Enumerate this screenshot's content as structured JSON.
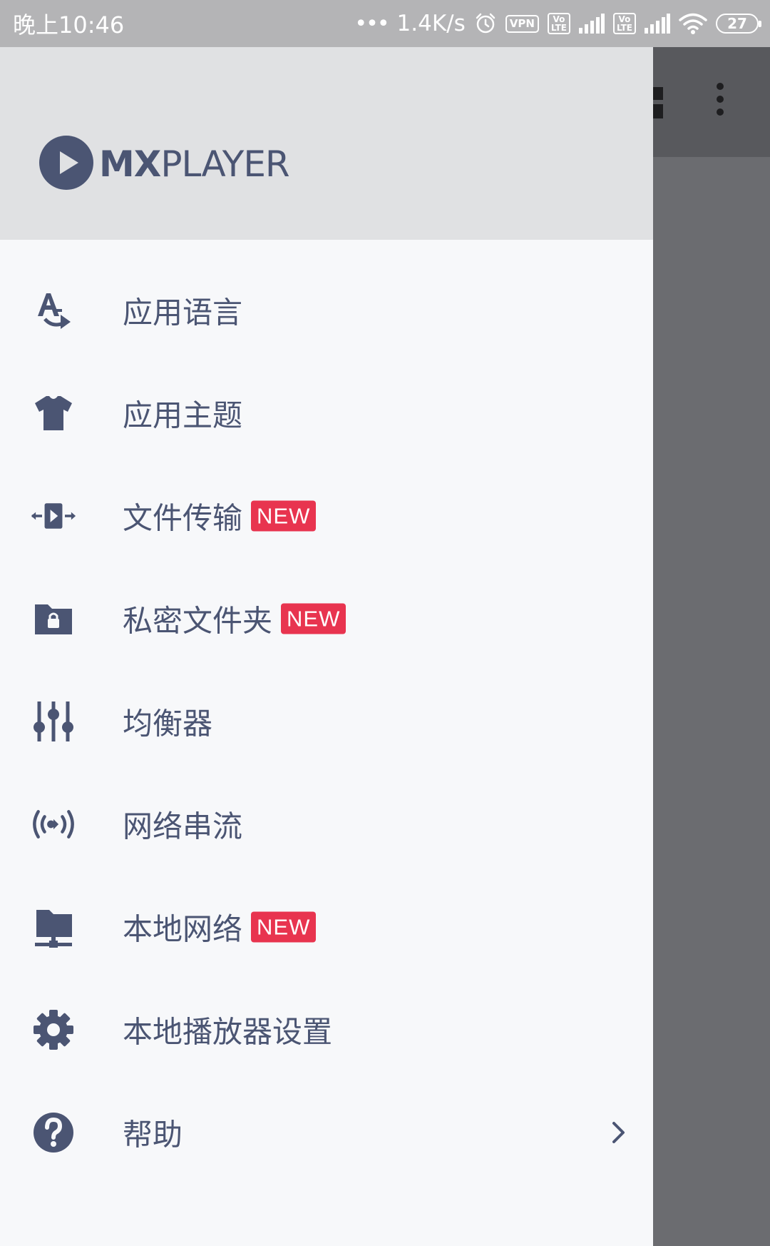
{
  "status_bar": {
    "time": "晚上10:46",
    "dots": "•••",
    "speed": "1.4K/s",
    "vpn": "VPN",
    "volte": [
      "Vo",
      "LTE"
    ],
    "battery": "27"
  },
  "drawer": {
    "logo": {
      "mx": "MX",
      "player": "PLAYER"
    },
    "menu": [
      {
        "icon": "language-icon",
        "label": "应用语言",
        "badge": ""
      },
      {
        "icon": "tshirt-icon",
        "label": "应用主题",
        "badge": ""
      },
      {
        "icon": "file-transfer-icon",
        "label": "文件传输",
        "badge": "NEW"
      },
      {
        "icon": "private-folder-icon",
        "label": "私密文件夹",
        "badge": "NEW"
      },
      {
        "icon": "equalizer-icon",
        "label": "均衡器",
        "badge": ""
      },
      {
        "icon": "network-stream-icon",
        "label": "网络串流",
        "badge": ""
      },
      {
        "icon": "local-network-icon",
        "label": "本地网络",
        "badge": "NEW"
      },
      {
        "icon": "gear-icon",
        "label": "本地播放器设置",
        "badge": ""
      },
      {
        "icon": "help-icon",
        "label": "帮助",
        "badge": ""
      }
    ]
  },
  "colors": {
    "icon": "#4b5573",
    "badge": "#e8344f",
    "drawer_bg": "#f7f8fa",
    "header_bg": "#e0e1e3",
    "scrim": "#6b6c70",
    "status_bar": "#b4b4b6"
  }
}
